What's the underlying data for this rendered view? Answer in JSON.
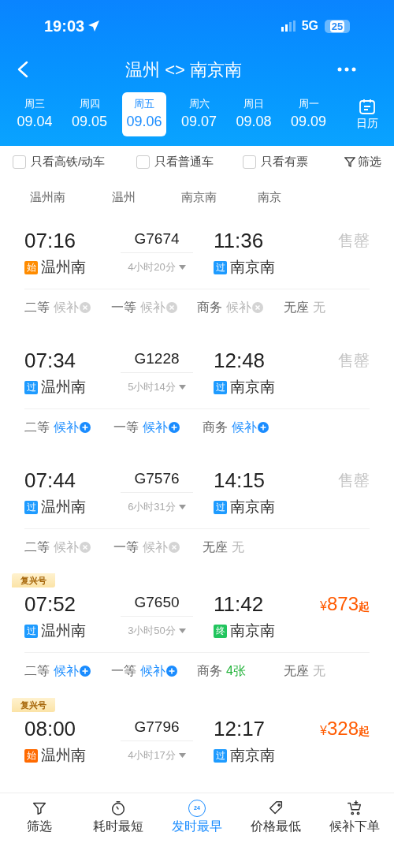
{
  "status_bar": {
    "time": "19:03",
    "network": "5G",
    "battery": "25"
  },
  "header": {
    "title": "温州 <> 南京南"
  },
  "dates": [
    {
      "weekday": "周三",
      "date": "09.04",
      "selected": false
    },
    {
      "weekday": "周四",
      "date": "09.05",
      "selected": false
    },
    {
      "weekday": "周五",
      "date": "09.06",
      "selected": true
    },
    {
      "weekday": "周六",
      "date": "09.07",
      "selected": false
    },
    {
      "weekday": "周日",
      "date": "09.08",
      "selected": false
    },
    {
      "weekday": "周一",
      "date": "09.09",
      "selected": false
    }
  ],
  "calendar_label": "日历",
  "filters": [
    {
      "label": "只看高铁/动车",
      "checked": false
    },
    {
      "label": "只看普通车",
      "checked": false
    },
    {
      "label": "只看有票",
      "checked": false
    }
  ],
  "filter_button": "筛选",
  "stations": [
    "温州南",
    "温州",
    "南京南",
    "南京"
  ],
  "trains": [
    {
      "depart": "07:16",
      "number": "G7674",
      "arrive": "11:36",
      "duration": "4小时20分",
      "from_badge": {
        "text": "始",
        "color": "#ff8c00"
      },
      "from": "温州南",
      "to_badge": {
        "text": "过",
        "color": "#1e9bff"
      },
      "to": "南京南",
      "price": {
        "kind": "soldout",
        "text": "售罄"
      },
      "seats": [
        {
          "class": "二等",
          "kind": "waitlist_closed",
          "status": "候补"
        },
        {
          "class": "一等",
          "kind": "waitlist_closed",
          "status": "候补"
        },
        {
          "class": "商务",
          "kind": "waitlist_closed",
          "status": "候补"
        },
        {
          "class": "无座",
          "kind": "none",
          "status": "无"
        }
      ]
    },
    {
      "depart": "07:34",
      "number": "G1228",
      "arrive": "12:48",
      "duration": "5小时14分",
      "from_badge": {
        "text": "过",
        "color": "#1e9bff"
      },
      "from": "温州南",
      "to_badge": {
        "text": "过",
        "color": "#1e9bff"
      },
      "to": "南京南",
      "price": {
        "kind": "soldout",
        "text": "售罄"
      },
      "seats": [
        {
          "class": "二等",
          "kind": "waitlist",
          "status": "候补"
        },
        {
          "class": "一等",
          "kind": "waitlist",
          "status": "候补"
        },
        {
          "class": "商务",
          "kind": "waitlist",
          "status": "候补"
        }
      ]
    },
    {
      "depart": "07:44",
      "number": "G7576",
      "arrive": "14:15",
      "duration": "6小时31分",
      "from_badge": {
        "text": "过",
        "color": "#1e9bff"
      },
      "from": "温州南",
      "to_badge": {
        "text": "过",
        "color": "#1e9bff"
      },
      "to": "南京南",
      "price": {
        "kind": "soldout",
        "text": "售罄"
      },
      "seats": [
        {
          "class": "二等",
          "kind": "waitlist_closed",
          "status": "候补"
        },
        {
          "class": "一等",
          "kind": "waitlist_closed",
          "status": "候补"
        },
        {
          "class": "无座",
          "kind": "none",
          "status": "无"
        }
      ]
    },
    {
      "tag": "复兴号",
      "depart": "07:52",
      "number": "G7650",
      "arrive": "11:42",
      "duration": "3小时50分",
      "from_badge": {
        "text": "过",
        "color": "#1e9bff"
      },
      "from": "温州南",
      "to_badge": {
        "text": "终",
        "color": "#22c55e"
      },
      "to": "南京南",
      "price": {
        "kind": "price",
        "currency": "¥",
        "amount": "873",
        "suffix": "起"
      },
      "seats": [
        {
          "class": "二等",
          "kind": "waitlist",
          "status": "候补"
        },
        {
          "class": "一等",
          "kind": "waitlist",
          "status": "候补"
        },
        {
          "class": "商务",
          "kind": "available",
          "status": "4张"
        },
        {
          "class": "无座",
          "kind": "none",
          "status": "无"
        }
      ]
    },
    {
      "tag": "复兴号",
      "depart": "08:00",
      "number": "G7796",
      "arrive": "12:17",
      "duration": "4小时17分",
      "from_badge": {
        "text": "始",
        "color": "#ff6a00"
      },
      "from": "温州南",
      "to_badge": {
        "text": "过",
        "color": "#1e9bff"
      },
      "to": "南京南",
      "price": {
        "kind": "price",
        "currency": "¥",
        "amount": "328",
        "suffix": "起"
      }
    }
  ],
  "sort_tabs": [
    {
      "label": "筛选",
      "selected": false
    },
    {
      "label": "耗时最短",
      "selected": false
    },
    {
      "badge": "24",
      "label": "发时最早",
      "selected": true
    },
    {
      "label": "价格最低",
      "selected": false
    },
    {
      "label": "候补下单",
      "selected": false
    }
  ]
}
